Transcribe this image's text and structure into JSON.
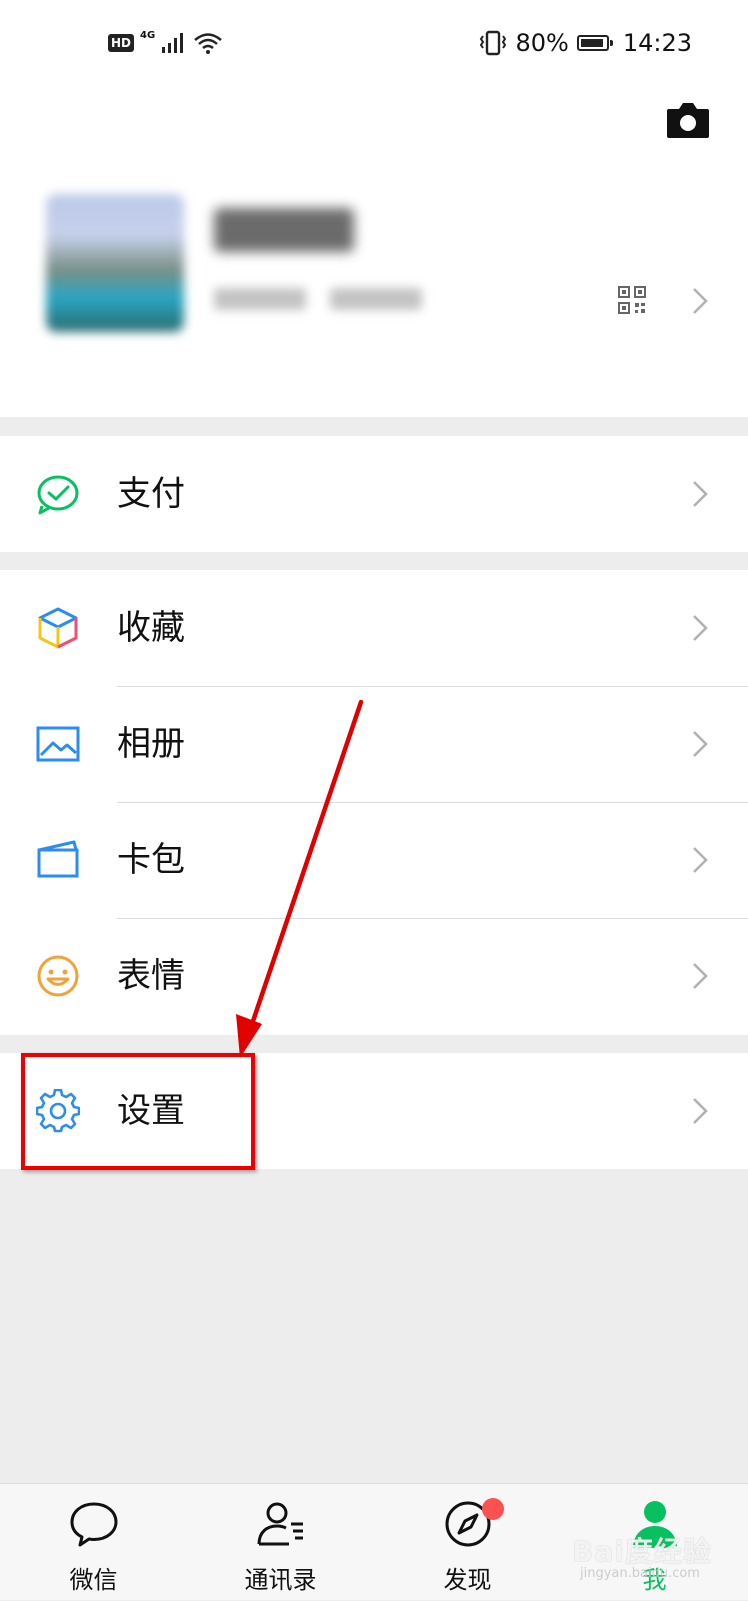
{
  "status_bar": {
    "hd": "HD",
    "network": "4G",
    "battery_pct": "80%",
    "time": "14:23"
  },
  "menu": {
    "pay": "支付",
    "favorites": "收藏",
    "album": "相册",
    "cards": "卡包",
    "stickers": "表情",
    "settings": "设置"
  },
  "tabs": [
    {
      "label": "微信"
    },
    {
      "label": "通讯录"
    },
    {
      "label": "发现"
    },
    {
      "label": "我"
    }
  ],
  "active_tab": "我",
  "watermark": {
    "text": "Bai度经验",
    "sub": "jingyan.baidu.com"
  },
  "colors": {
    "brand_green": "#07c160",
    "accent_blue": "#2d8cf0",
    "sticker_orange": "#f0a33a",
    "annotation_red": "#e00000",
    "badge_red": "#fa5151"
  },
  "icons": [
    "camera-icon",
    "qr-code-icon",
    "pay-icon",
    "favorites-icon",
    "album-icon",
    "card-wallet-icon",
    "sticker-icon",
    "settings-gear-icon",
    "chat-bubble-icon",
    "contacts-icon",
    "compass-icon",
    "me-icon"
  ]
}
